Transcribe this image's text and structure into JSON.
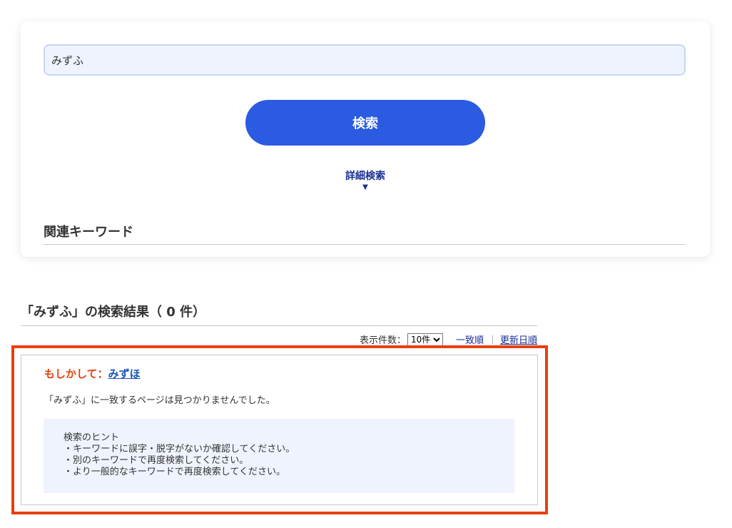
{
  "search": {
    "query_value": "みずふ",
    "button_label": "検索",
    "advanced_label": "詳細検索",
    "advanced_arrow": "▼",
    "related_keywords_title": "関連キーワード"
  },
  "results": {
    "heading": "「みずふ」の検索結果（ 0 件）",
    "display_count_label": "表示件数：",
    "display_count_options": [
      "10件"
    ],
    "display_count_selected": "10件",
    "sort_relevance": "一致順",
    "sort_separator": "｜",
    "sort_date": "更新日順",
    "suggestion_prefix": "もしかして：",
    "suggestion_term": "みずほ",
    "no_results_message": "「みずふ」に一致するページは見つかりませんでした。",
    "hints": {
      "title": "検索のヒント",
      "items": [
        "・キーワードに誤字・脱字がないか確認してください。",
        "・別のキーワードで再度検索してください。",
        "・より一般的なキーワードで再度検索してください。"
      ]
    }
  },
  "colors": {
    "primary_button": "#2a5be1",
    "link": "#1a2f95",
    "suggestion_text": "#e8400c",
    "highlight_border": "#e8400c",
    "hint_background": "#eef3fd"
  }
}
